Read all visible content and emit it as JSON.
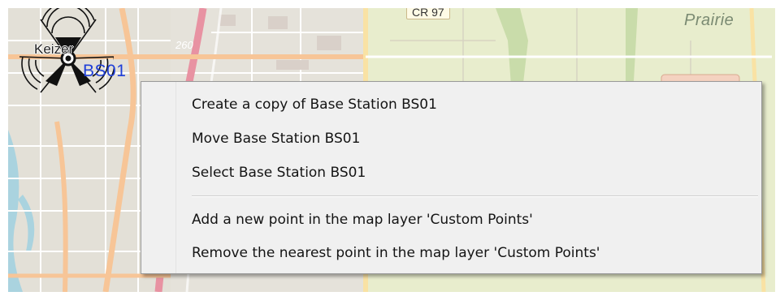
{
  "map": {
    "labels": {
      "prairie": "Prairie",
      "road_cr97": "CR 97",
      "highway_260": "260",
      "city": "Keizer"
    },
    "base_station": {
      "label": "BS01",
      "icon": "base-station-antenna-icon"
    },
    "colors": {
      "land": "#f2efe9",
      "fields": "#e7edcf",
      "residential": "#e3e0d7",
      "green": "#add19e",
      "primary_road": "#f7c597",
      "trunk_road": "#e892a2",
      "river": "#aad3df",
      "station_label": "#1f3fd8"
    }
  },
  "context_menu": {
    "items": [
      "Create a copy of Base Station BS01",
      "Move Base Station BS01",
      "Select Base Station BS01"
    ],
    "map_layer_items": [
      "Add a new point in the map layer 'Custom Points'",
      "Remove the nearest point in the map layer 'Custom Points'"
    ]
  }
}
